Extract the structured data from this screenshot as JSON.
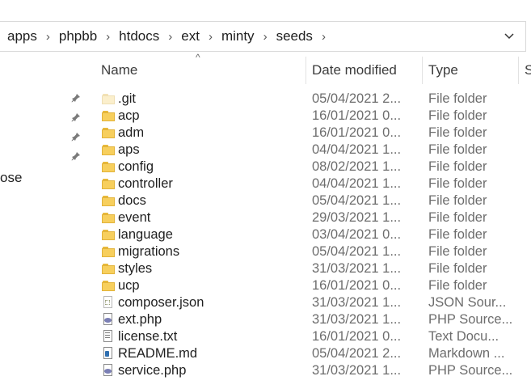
{
  "address_bar": {
    "crumbs": [
      "apps",
      "phpbb",
      "htdocs",
      "ext",
      "minty",
      "seeds"
    ],
    "dropdown_icon": "chevron-down-icon"
  },
  "navigation_pane": {
    "pinned_icon": "pin-icon",
    "partial_label": "ose"
  },
  "columns": {
    "name": "Name",
    "date_modified": "Date modified",
    "type": "Type",
    "size_partial": "S"
  },
  "files": [
    {
      "name": ".git",
      "date": "05/04/2021 2...",
      "type": "File folder",
      "icon": "folder-hidden-icon"
    },
    {
      "name": "acp",
      "date": "16/01/2021 0...",
      "type": "File folder",
      "icon": "folder-icon"
    },
    {
      "name": "adm",
      "date": "16/01/2021 0...",
      "type": "File folder",
      "icon": "folder-icon"
    },
    {
      "name": "aps",
      "date": "04/04/2021 1...",
      "type": "File folder",
      "icon": "folder-icon"
    },
    {
      "name": "config",
      "date": "08/02/2021 1...",
      "type": "File folder",
      "icon": "folder-icon"
    },
    {
      "name": "controller",
      "date": "04/04/2021 1...",
      "type": "File folder",
      "icon": "folder-icon"
    },
    {
      "name": "docs",
      "date": "05/04/2021 1...",
      "type": "File folder",
      "icon": "folder-icon"
    },
    {
      "name": "event",
      "date": "29/03/2021 1...",
      "type": "File folder",
      "icon": "folder-icon"
    },
    {
      "name": "language",
      "date": "03/04/2021 0...",
      "type": "File folder",
      "icon": "folder-icon"
    },
    {
      "name": "migrations",
      "date": "05/04/2021 1...",
      "type": "File folder",
      "icon": "folder-icon"
    },
    {
      "name": "styles",
      "date": "31/03/2021 1...",
      "type": "File folder",
      "icon": "folder-icon"
    },
    {
      "name": "ucp",
      "date": "16/01/2021 0...",
      "type": "File folder",
      "icon": "folder-icon"
    },
    {
      "name": "composer.json",
      "date": "31/03/2021 1...",
      "type": "JSON Sour...",
      "icon": "json-file-icon"
    },
    {
      "name": "ext.php",
      "date": "31/03/2021 1...",
      "type": "PHP Source...",
      "icon": "php-file-icon"
    },
    {
      "name": "license.txt",
      "date": "16/01/2021 0...",
      "type": "Text Docu...",
      "icon": "text-file-icon"
    },
    {
      "name": "README.md",
      "date": "05/04/2021 2...",
      "type": "Markdown ...",
      "icon": "markdown-file-icon"
    },
    {
      "name": "service.php",
      "date": "31/03/2021 1...",
      "type": "PHP Source...",
      "icon": "php-file-icon"
    }
  ]
}
